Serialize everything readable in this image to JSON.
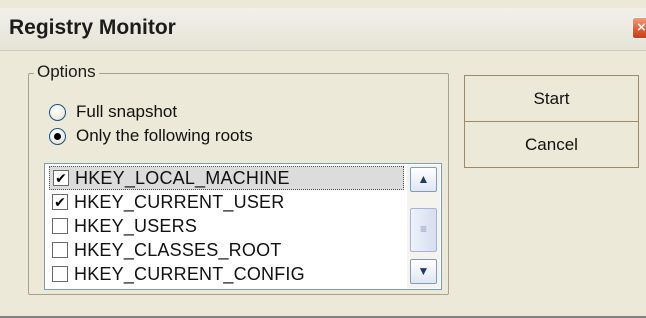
{
  "window": {
    "title": "Registry Monitor",
    "close_glyph": "×"
  },
  "options": {
    "legend": "Options",
    "radios": [
      {
        "label": "Full snapshot",
        "checked": false
      },
      {
        "label": "Only the following roots",
        "checked": true
      }
    ],
    "roots": [
      {
        "label": "HKEY_LOCAL_MACHINE",
        "checked": true,
        "selected": true
      },
      {
        "label": "HKEY_CURRENT_USER",
        "checked": true,
        "selected": false
      },
      {
        "label": "HKEY_USERS",
        "checked": false,
        "selected": false
      },
      {
        "label": "HKEY_CLASSES_ROOT",
        "checked": false,
        "selected": false
      },
      {
        "label": "HKEY_CURRENT_CONFIG",
        "checked": false,
        "selected": false
      }
    ]
  },
  "buttons": {
    "start_label": "Start",
    "cancel_label": "Cancel"
  },
  "icons": {
    "close": "close-icon",
    "scroll_up": "chevron-up-icon",
    "scroll_down": "chevron-down-icon",
    "check": "checkmark-icon",
    "check_glyph": "✔",
    "up_glyph": "▲",
    "down_glyph": "▼",
    "grip_glyph": "≡"
  },
  "colors": {
    "dialog_bg": "#ece9d8",
    "close_button": "#e2572f",
    "list_border": "#7f9db9",
    "selected_row": "#dcdcdc"
  }
}
